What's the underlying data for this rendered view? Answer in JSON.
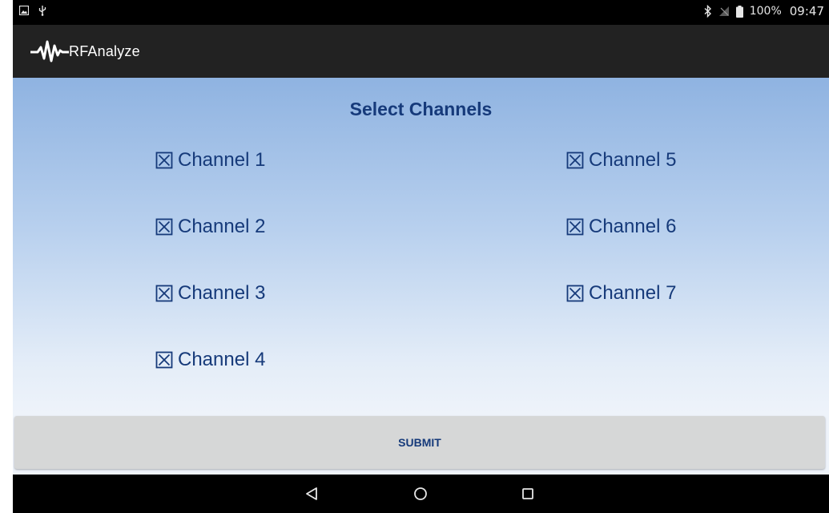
{
  "colors": {
    "accent": "#163a7a",
    "app_bar": "#222222",
    "status_bar": "#000000",
    "submit_bg": "#d6d7d7"
  },
  "status_bar": {
    "left_icons": [
      "image-icon",
      "usb-icon"
    ],
    "right_icons": [
      "bluetooth-icon",
      "no-sim-icon",
      "battery-icon"
    ],
    "battery": "100%",
    "time": "09:47"
  },
  "app_bar": {
    "title": "RFAnalyze",
    "logo_icon": "waveform-logo-icon"
  },
  "main": {
    "heading": "Select Channels",
    "channels": [
      {
        "label": "Channel 1",
        "checked": true
      },
      {
        "label": "Channel 2",
        "checked": true
      },
      {
        "label": "Channel 3",
        "checked": true
      },
      {
        "label": "Channel 4",
        "checked": true
      },
      {
        "label": "Channel 5",
        "checked": true
      },
      {
        "label": "Channel 6",
        "checked": true
      },
      {
        "label": "Channel 7",
        "checked": true
      }
    ],
    "submit_label": "SUBMIT"
  },
  "nav_bar": {
    "icons": [
      "back-icon",
      "home-icon",
      "recents-icon"
    ]
  }
}
